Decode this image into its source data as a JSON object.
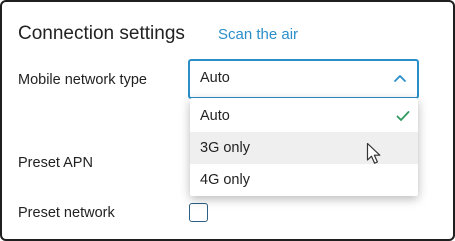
{
  "header": {
    "title": "Connection settings",
    "scan_link": "Scan the air"
  },
  "form": {
    "network_type_label": "Mobile network type",
    "network_type_value": "Auto",
    "preset_apn_label": "Preset APN",
    "preset_network_label": "Preset network",
    "preset_network_checked": false
  },
  "dropdown": {
    "options": [
      {
        "label": "Auto",
        "selected": true
      },
      {
        "label": "3G only",
        "selected": false
      },
      {
        "label": "4G only",
        "selected": false
      }
    ]
  },
  "colors": {
    "accent": "#2b8ec9",
    "check": "#2e9a5e",
    "hover": "#efefef"
  },
  "icons": {
    "select_chevron": "chevron-up-icon",
    "selected_mark": "check-icon",
    "pointer": "mouse-cursor-icon"
  }
}
